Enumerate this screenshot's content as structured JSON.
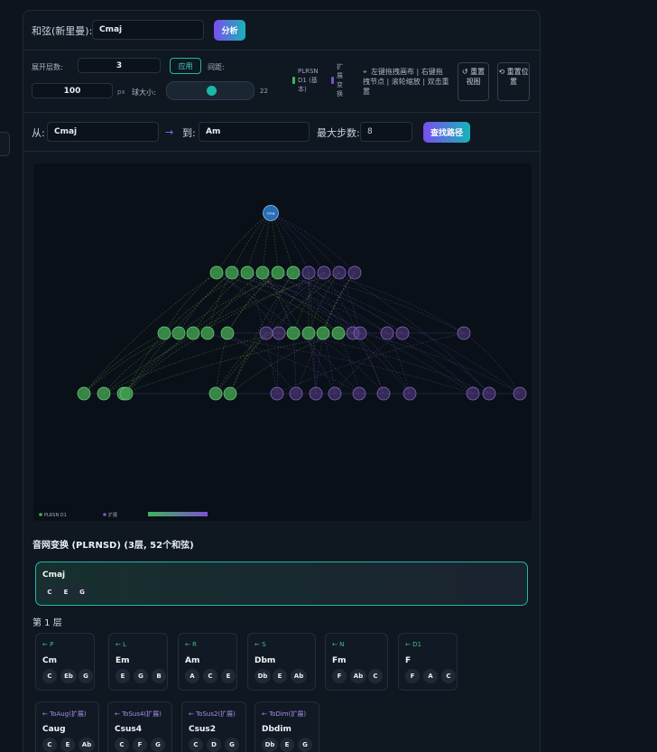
{
  "search": {
    "chord_label": "和弦(新里曼):",
    "chord_value": "Cmaj",
    "analyze_label": "分析"
  },
  "controls": {
    "depth_label": "展开层数:",
    "depth_value": "3",
    "apply_label": "应用",
    "spacing_label": "间距:",
    "spacing_value": "100",
    "spacing_unit": "px",
    "ball_size_label": "球大小:",
    "ball_size_value": "22",
    "ball_size_level": 0.55,
    "legend_plrsn": "PLRSN D1 (基本)",
    "legend_ext": "扩展变换",
    "hint": "左键拖拽画布 | 右键拖拽节点 | 滚轮缩放 | 双击重置",
    "reset_view": "↺ 重置视图",
    "reset_pos": "⟲ 重置位置"
  },
  "path": {
    "from_label": "从:",
    "from_value": "Cmaj",
    "arrow": "→",
    "to_label": "到:",
    "to_value": "Am",
    "max_steps_label": "最大步数:",
    "max_steps_value": "8",
    "find_label": "查找路径"
  },
  "graph": {
    "root_label": "Cmaj",
    "legend_basic": "PLRSN D1",
    "legend_ext": "扩展",
    "colors": {
      "basic": "#3f9a4e",
      "ext": "#5a3f86",
      "root": "#2d7bd1"
    }
  },
  "network": {
    "title": "音网变换 (PLRNSD) (3层, 52个和弦)",
    "selected": {
      "name": "Cmaj",
      "notes": [
        "C",
        "E",
        "G"
      ]
    },
    "layer_title": "第 1 层",
    "cards": [
      {
        "from": "← P",
        "name": "Cm",
        "notes": [
          "C",
          "Eb",
          "G"
        ],
        "kind": "basic"
      },
      {
        "from": "← L",
        "name": "Em",
        "notes": [
          "E",
          "G",
          "B"
        ],
        "kind": "basic"
      },
      {
        "from": "← R",
        "name": "Am",
        "notes": [
          "A",
          "C",
          "E"
        ],
        "kind": "basic"
      },
      {
        "from": "← S",
        "name": "Dbm",
        "notes": [
          "Db",
          "E",
          "Ab"
        ],
        "kind": "basic"
      },
      {
        "from": "← N",
        "name": "Fm",
        "notes": [
          "F",
          "Ab",
          "C"
        ],
        "kind": "basic"
      },
      {
        "from": "← D1",
        "name": "F",
        "notes": [
          "F",
          "A",
          "C"
        ],
        "kind": "basic"
      },
      {
        "from": "← ToAug(扩展)",
        "name": "Caug",
        "notes": [
          "C",
          "E",
          "Ab"
        ],
        "kind": "ext"
      },
      {
        "from": "← ToSus4(扩展)",
        "name": "Csus4",
        "notes": [
          "C",
          "F",
          "G"
        ],
        "kind": "ext"
      },
      {
        "from": "← ToSus2(扩展)",
        "name": "Csus2",
        "notes": [
          "C",
          "D",
          "G"
        ],
        "kind": "ext"
      },
      {
        "from": "← ToDim(扩展)",
        "name": "Dbdim",
        "notes": [
          "Db",
          "E",
          "G"
        ],
        "kind": "ext"
      }
    ]
  }
}
